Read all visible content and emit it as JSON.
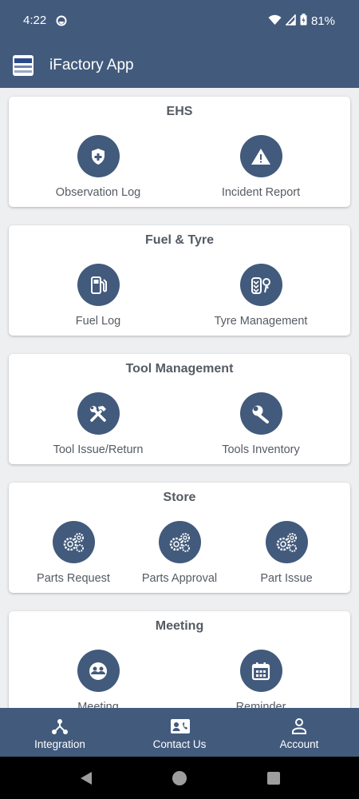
{
  "status_bar": {
    "time": "4:22",
    "battery": "81%"
  },
  "app_bar": {
    "title": "iFactory App"
  },
  "sections": [
    {
      "title": "EHS",
      "items": [
        {
          "label": "Observation Log",
          "icon": "shield-plus-icon"
        },
        {
          "label": "Incident Report",
          "icon": "warning-icon"
        }
      ]
    },
    {
      "title": "Fuel & Tyre",
      "items": [
        {
          "label": "Fuel Log",
          "icon": "fuel-pump-icon"
        },
        {
          "label": "Tyre Management",
          "icon": "tyre-location-icon"
        }
      ]
    },
    {
      "title": "Tool Management",
      "items": [
        {
          "label": "Tool Issue/Return",
          "icon": "hammer-wrench-icon"
        },
        {
          "label": "Tools Inventory",
          "icon": "wrench-icon"
        }
      ]
    },
    {
      "title": "Store",
      "items": [
        {
          "label": "Parts Request",
          "icon": "gears-icon"
        },
        {
          "label": "Parts Approval",
          "icon": "gears-icon"
        },
        {
          "label": "Part Issue",
          "icon": "gears-icon"
        }
      ]
    },
    {
      "title": "Meeting",
      "items": [
        {
          "label": "Meeting",
          "icon": "meeting-icon"
        },
        {
          "label": "Reminder",
          "icon": "calendar-icon"
        }
      ]
    }
  ],
  "bottom_nav": [
    {
      "label": "Integration",
      "icon": "integration-icon"
    },
    {
      "label": "Contact Us",
      "icon": "contact-card-icon"
    },
    {
      "label": "Account",
      "icon": "person-icon"
    }
  ],
  "colors": {
    "primary": "#425a7c",
    "background": "#eeeff1",
    "text": "#555b63"
  }
}
